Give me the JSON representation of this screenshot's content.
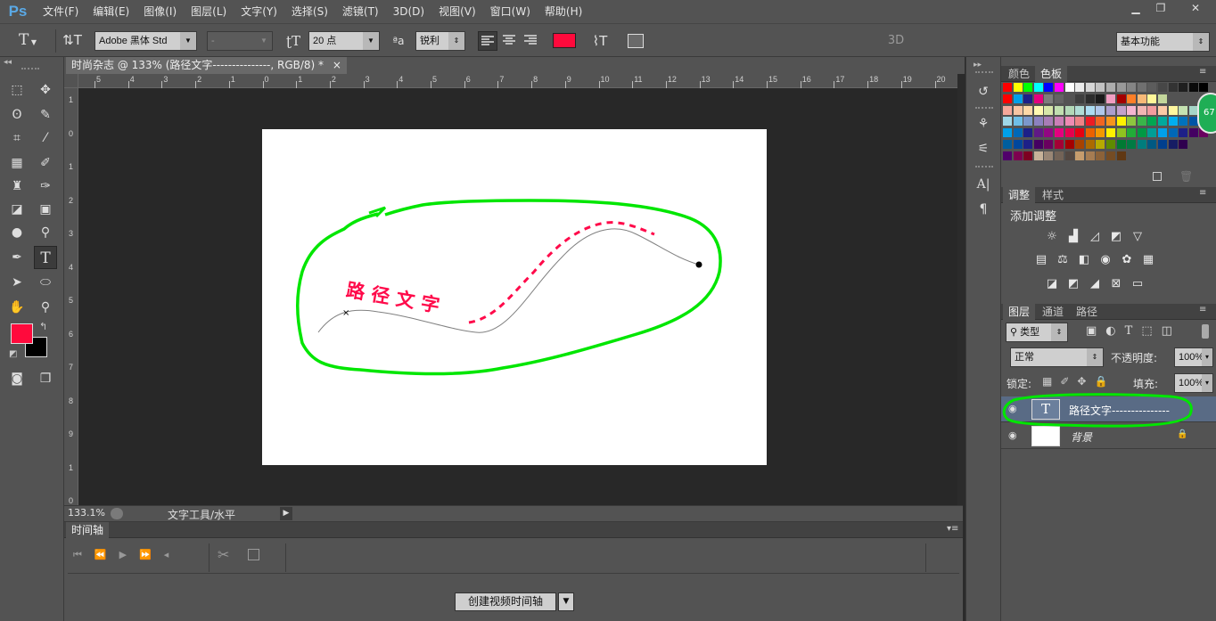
{
  "app": {
    "logo": "Ps"
  },
  "menu": [
    "文件(F)",
    "编辑(E)",
    "图像(I)",
    "图层(L)",
    "文字(Y)",
    "选择(S)",
    "滤镜(T)",
    "3D(D)",
    "视图(V)",
    "窗口(W)",
    "帮助(H)"
  ],
  "window_controls": {
    "minimize": "▁",
    "restore": "❐",
    "close": "✕"
  },
  "options": {
    "tool_glyph": "T",
    "font_family": "Adobe 黑体 Std",
    "font_style": "-",
    "font_size": "20 点",
    "antialias_glyph": "ªa",
    "antialias": "锐利",
    "text_color": "#ff0a3c",
    "label_3d": "3D",
    "workspace": "基本功能"
  },
  "document": {
    "tab_title": "时尚杂志 @ 133% (路径文字---------------, RGB/8) *",
    "close": "×",
    "path_text": "路 径 文 字",
    "ruler_h": [
      "5",
      "4",
      "3",
      "2",
      "1",
      "0",
      "1",
      "2",
      "3",
      "4",
      "5",
      "6",
      "7",
      "8",
      "9",
      "10",
      "11",
      "12",
      "13",
      "14",
      "15",
      "16",
      "17",
      "18",
      "19",
      "20"
    ],
    "ruler_v": [
      "1",
      "0",
      "1",
      "2",
      "3",
      "4",
      "5",
      "6",
      "7",
      "8",
      "9",
      "1",
      "0"
    ]
  },
  "status": {
    "zoom": "133.1%",
    "info": "文字工具/水平"
  },
  "timeline": {
    "tab": "时间轴",
    "create_button": "创建视频时间轴"
  },
  "colors": {
    "foreground": "#ff0a3c",
    "background": "#000000",
    "annotation": "#00e600"
  },
  "panels": {
    "color_tabs": [
      "颜色",
      "色板"
    ],
    "adjust_tabs": [
      "调整",
      "样式"
    ],
    "adjust_title": "添加调整",
    "layers_tabs": [
      "图层",
      "通道",
      "路径"
    ],
    "filter_kind": "类型",
    "blend_mode": "正常",
    "opacity_label": "不透明度:",
    "opacity_value": "100%",
    "lock_label": "锁定:",
    "fill_label": "填充:",
    "fill_value": "100%",
    "side_badge": "67"
  },
  "layers": [
    {
      "name": "路径文字---------------",
      "type": "text",
      "thumb": "T"
    },
    {
      "name": "背景",
      "type": "background"
    }
  ],
  "swatches": [
    [
      "#ff0000",
      "#ffff00",
      "#00ff00",
      "#00ffff",
      "#0000ff",
      "#ff00ff",
      "#ffffff",
      "#ebebeb",
      "#d6d6d6",
      "#c2c2c2",
      "#adadad",
      "#999999",
      "#858585",
      "#707070",
      "#5c5c5c",
      "#474747",
      "#333333",
      "#1f1f1f",
      "#0a0a0a",
      "#000000"
    ],
    [
      "#ff0000",
      "#00a0e9",
      "#1d2088",
      "#e4007f",
      "#7d7d7d",
      "#636363",
      "#535353",
      "#3e3e3e",
      "#2c2c2c",
      "#1a1a1a",
      "#f19ec2",
      "#a40000",
      "#ff7f27",
      "#f7b977",
      "#fff799",
      "#c3d69b"
    ],
    [
      "#f5a89a",
      "#f8c5a3",
      "#fdd8a7",
      "#fff9b1",
      "#d7e7a9",
      "#c1dfb0",
      "#b2d8b7",
      "#b0dcd5",
      "#acdcf1",
      "#afc7ea",
      "#ab9ecd",
      "#c3a1cb",
      "#f4b5d0",
      "#f2b5b3",
      "#f29c9f",
      "#fcc9a6",
      "#fff79f",
      "#c5e2b1",
      "#a6d5c8",
      "#9ed6e4"
    ],
    [
      "#9fd8e8",
      "#6fbfe8",
      "#7b98cc",
      "#8c81bf",
      "#a87cb6",
      "#ca7fb6",
      "#ee8ab3",
      "#ee8386",
      "#ed1c24",
      "#f26522",
      "#f7941d",
      "#fff200",
      "#8dc63f",
      "#39b54a",
      "#00a651",
      "#00a99d",
      "#00aeef",
      "#0072bc",
      "#0054a6",
      "#2e3192"
    ],
    [
      "#00a0e9",
      "#0068b7",
      "#1d2088",
      "#601986",
      "#920783",
      "#e4007f",
      "#e5004f",
      "#e60012",
      "#eb6100",
      "#f39800",
      "#fff100",
      "#8fc31f",
      "#22ac38",
      "#009944",
      "#009e96",
      "#00a0e9",
      "#0068b7",
      "#1d2088",
      "#440062",
      "#6a005f"
    ],
    [
      "#005e9e",
      "#00479d",
      "#1d2088",
      "#440062",
      "#6a005f",
      "#a40035",
      "#a40000",
      "#a84200",
      "#ac6a00",
      "#b7aa00",
      "#5f8b00",
      "#007a33",
      "#007b43",
      "#007d7d",
      "#005982",
      "#003f8e",
      "#161d64",
      "#2f004e"
    ],
    [
      "#50006b",
      "#7d0050",
      "#7d0022",
      "#c7b299",
      "#998675",
      "#736357",
      "#534741",
      "#c69c6d",
      "#a67c52",
      "#8c6239",
      "#754c24",
      "#603813"
    ]
  ]
}
